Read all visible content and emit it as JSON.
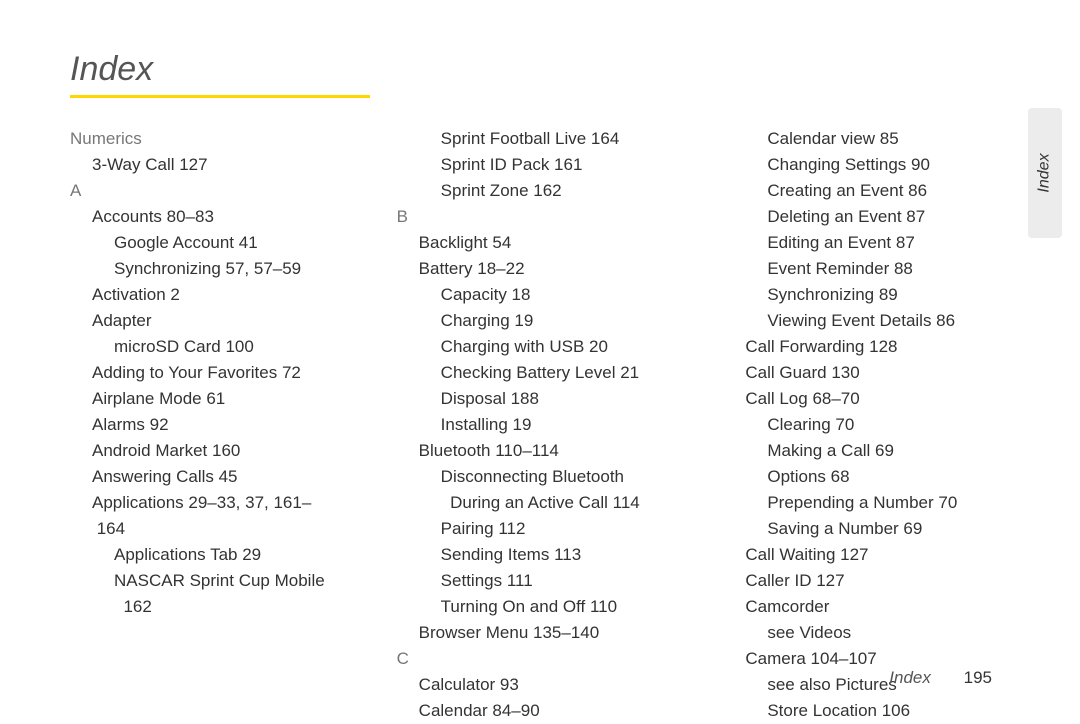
{
  "title": "Index",
  "side_tab": "Index",
  "footer": {
    "label": "Index",
    "page": "195"
  },
  "col1": [
    {
      "cls": "group",
      "t": "Numerics"
    },
    {
      "cls": "sub1",
      "t": "3-Way Call 127"
    },
    {
      "cls": "letter",
      "t": "A"
    },
    {
      "cls": "sub1",
      "t": "Accounts 80–83"
    },
    {
      "cls": "sub2",
      "t": "Google Account 41"
    },
    {
      "cls": "sub2",
      "t": "Synchronizing 57, 57–59"
    },
    {
      "cls": "sub1",
      "t": "Activation 2"
    },
    {
      "cls": "sub1",
      "t": "Adapter"
    },
    {
      "cls": "sub2",
      "t": "microSD Card 100"
    },
    {
      "cls": "sub1",
      "t": "Adding to Your Favorites 72"
    },
    {
      "cls": "sub1",
      "t": "Airplane Mode 61"
    },
    {
      "cls": "sub1",
      "t": "Alarms 92"
    },
    {
      "cls": "sub1",
      "t": "Android Market 160"
    },
    {
      "cls": "sub1",
      "t": "Answering Calls 45"
    },
    {
      "cls": "sub1",
      "t": "Applications 29–33, 37, 161–"
    },
    {
      "cls": "sub1",
      "t": " 164"
    },
    {
      "cls": "sub2",
      "t": "Applications Tab 29"
    },
    {
      "cls": "sub2",
      "t": "NASCAR Sprint Cup Mobile"
    },
    {
      "cls": "sub2",
      "t": "  162"
    }
  ],
  "col2": [
    {
      "cls": "sub2",
      "t": "Sprint Football Live 164"
    },
    {
      "cls": "sub2",
      "t": "Sprint ID Pack 161"
    },
    {
      "cls": "sub2",
      "t": "Sprint Zone 162"
    },
    {
      "cls": "letter",
      "t": "B"
    },
    {
      "cls": "sub1",
      "t": "Backlight 54"
    },
    {
      "cls": "sub1",
      "t": "Battery 18–22"
    },
    {
      "cls": "sub2",
      "t": "Capacity 18"
    },
    {
      "cls": "sub2",
      "t": "Charging 19"
    },
    {
      "cls": "sub2",
      "t": "Charging with USB 20"
    },
    {
      "cls": "sub2",
      "t": "Checking Battery Level 21"
    },
    {
      "cls": "sub2",
      "t": "Disposal 188"
    },
    {
      "cls": "sub2",
      "t": "Installing 19"
    },
    {
      "cls": "sub1",
      "t": "Bluetooth 110–114"
    },
    {
      "cls": "sub2",
      "t": "Disconnecting Bluetooth"
    },
    {
      "cls": "sub2",
      "t": "  During an Active Call 114"
    },
    {
      "cls": "sub2",
      "t": "Pairing 112"
    },
    {
      "cls": "sub2",
      "t": "Sending Items 113"
    },
    {
      "cls": "sub2",
      "t": "Settings 111"
    },
    {
      "cls": "sub2",
      "t": "Turning On and Off 110"
    },
    {
      "cls": "sub1",
      "t": "Browser Menu 135–140"
    },
    {
      "cls": "letter",
      "t": "C"
    },
    {
      "cls": "sub1",
      "t": "Calculator 93"
    },
    {
      "cls": "sub1",
      "t": "Calendar 84–90"
    }
  ],
  "col3": [
    {
      "cls": "sub2",
      "t": "Calendar view 85"
    },
    {
      "cls": "sub2",
      "t": "Changing Settings 90"
    },
    {
      "cls": "sub2",
      "t": "Creating an Event 86"
    },
    {
      "cls": "sub2",
      "t": "Deleting an Event 87"
    },
    {
      "cls": "sub2",
      "t": "Editing an Event 87"
    },
    {
      "cls": "sub2",
      "t": "Event Reminder 88"
    },
    {
      "cls": "sub2",
      "t": "Synchronizing 89"
    },
    {
      "cls": "sub2",
      "t": "Viewing Event Details 86"
    },
    {
      "cls": "sub1",
      "t": "Call Forwarding 128"
    },
    {
      "cls": "sub1",
      "t": "Call Guard 130"
    },
    {
      "cls": "sub1",
      "t": "Call Log 68–70"
    },
    {
      "cls": "sub2",
      "t": "Clearing 70"
    },
    {
      "cls": "sub2",
      "t": "Making a Call 69"
    },
    {
      "cls": "sub2",
      "t": "Options 68"
    },
    {
      "cls": "sub2",
      "t": "Prepending a Number 70"
    },
    {
      "cls": "sub2",
      "t": "Saving a Number 69"
    },
    {
      "cls": "sub1",
      "t": "Call Waiting 127"
    },
    {
      "cls": "sub1",
      "t": "Caller ID 127"
    },
    {
      "cls": "sub1",
      "t": "Camcorder"
    },
    {
      "cls": "sub2",
      "t": "see Videos"
    },
    {
      "cls": "sub1",
      "t": "Camera 104–107"
    },
    {
      "cls": "sub2",
      "t": "see also Pictures"
    },
    {
      "cls": "sub2",
      "t": "Store Location 106"
    }
  ]
}
